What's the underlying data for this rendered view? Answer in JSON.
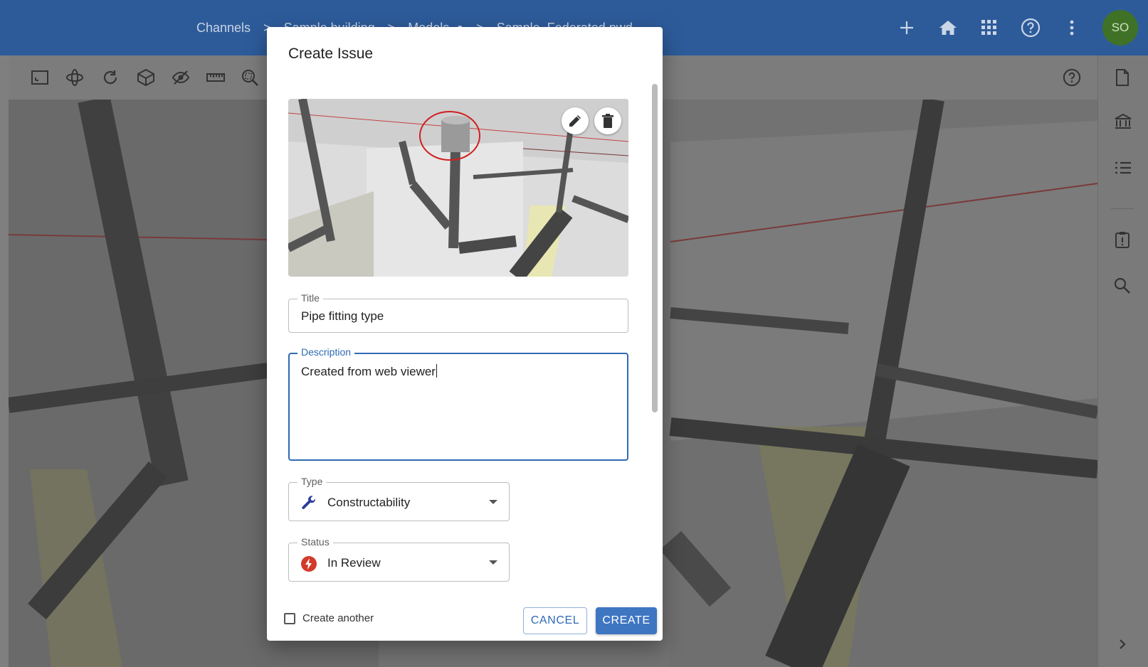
{
  "breadcrumbs": [
    {
      "label": "Channels"
    },
    {
      "label": "Sample building"
    },
    {
      "label": "Models"
    },
    {
      "label": "Sample_Federated.nwd"
    }
  ],
  "user": {
    "initials": "SO"
  },
  "icons": {
    "top": [
      "plus-icon",
      "home-icon",
      "apps-grid-icon",
      "help-icon",
      "more-vert-icon"
    ],
    "toolbar": [
      "fit-view-icon",
      "orbit-icon",
      "reset-icon",
      "section-box-icon",
      "hide-icon",
      "measure-icon",
      "zoom-select-icon",
      "help-icon"
    ],
    "rightbar": [
      "document-icon",
      "bank-icon",
      "list-icon",
      "issue-icon",
      "search-icon",
      "chevron-right-icon"
    ]
  },
  "dialog": {
    "title": "Create Issue",
    "title_field": {
      "label": "Title",
      "value": "Pipe fitting type"
    },
    "description_field": {
      "label": "Description",
      "value": "Created from web viewer"
    },
    "type_field": {
      "label": "Type",
      "value": "Constructability",
      "icon": "wrench-icon"
    },
    "status_field": {
      "label": "Status",
      "value": "In Review",
      "icon": "lightning-icon"
    },
    "create_another_label": "Create another",
    "cancel_label": "CANCEL",
    "create_label": "CREATE"
  },
  "colors": {
    "header": "#2d5b9a",
    "primary": "#3f76c2",
    "avatar": "#3f7226",
    "status_red": "#d23a2a",
    "type_blue": "#2a3f9e"
  }
}
